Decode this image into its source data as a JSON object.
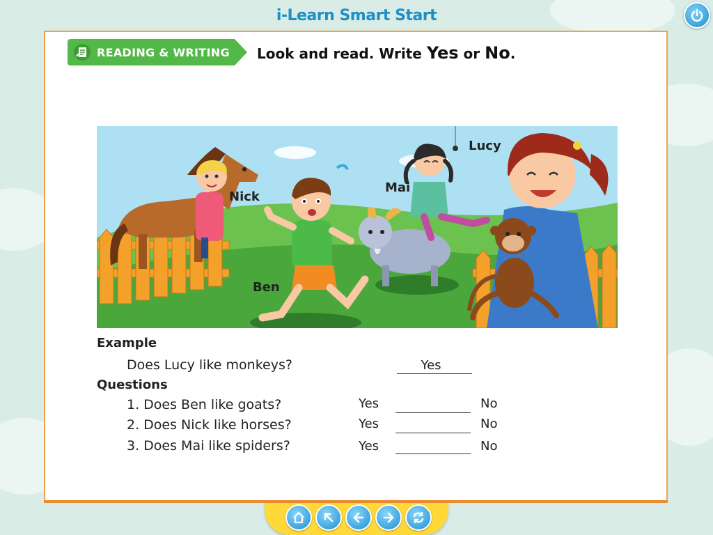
{
  "app": {
    "title": "i-Learn Smart Start"
  },
  "header": {
    "badge_label": "READING & WRITING",
    "instruction_prefix": "Look and read. Write ",
    "instruction_yes": "Yes",
    "instruction_or": " or ",
    "instruction_no": "No",
    "instruction_end": "."
  },
  "scene": {
    "labels": {
      "nick": "Nick",
      "mai": "Mai",
      "lucy": "Lucy",
      "ben": "Ben"
    }
  },
  "example": {
    "heading": "Example",
    "question": "Does Lucy like monkeys?",
    "answer": "Yes"
  },
  "questions": {
    "heading": "Questions",
    "items": [
      {
        "text": "1. Does Ben like goats?",
        "yes": "Yes",
        "no": "No"
      },
      {
        "text": "2. Does Nick like horses?",
        "yes": "Yes",
        "no": "No"
      },
      {
        "text": "3. Does Mai like spiders?",
        "yes": "Yes",
        "no": "No"
      }
    ]
  },
  "toolbar": {
    "buttons": [
      "home-icon",
      "arrow-up-left-icon",
      "arrow-left-icon",
      "arrow-right-icon",
      "refresh-icon"
    ]
  },
  "colors": {
    "accent": "#1f8fc6",
    "badge": "#52b847",
    "frame": "#f0a24a",
    "dock": "#ffd93a"
  }
}
